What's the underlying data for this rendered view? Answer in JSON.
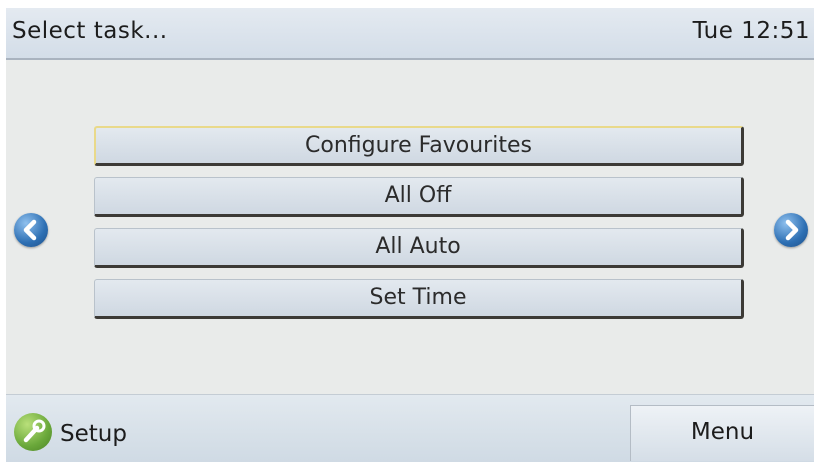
{
  "header": {
    "title": "Select task...",
    "clock": "Tue 12:51"
  },
  "tasks": [
    {
      "label": "Configure Favourites"
    },
    {
      "label": "All Off"
    },
    {
      "label": "All Auto"
    },
    {
      "label": "Set Time"
    }
  ],
  "nav": {
    "prev_icon": "chevron-left-icon",
    "next_icon": "chevron-right-icon"
  },
  "footer": {
    "setup_label": "Setup",
    "setup_icon": "wrench-icon",
    "menu_label": "Menu"
  },
  "colors": {
    "accent_blue": "#2d6fb3",
    "setup_green": "#6aa83a",
    "button_shadow": "#3c3a36"
  }
}
